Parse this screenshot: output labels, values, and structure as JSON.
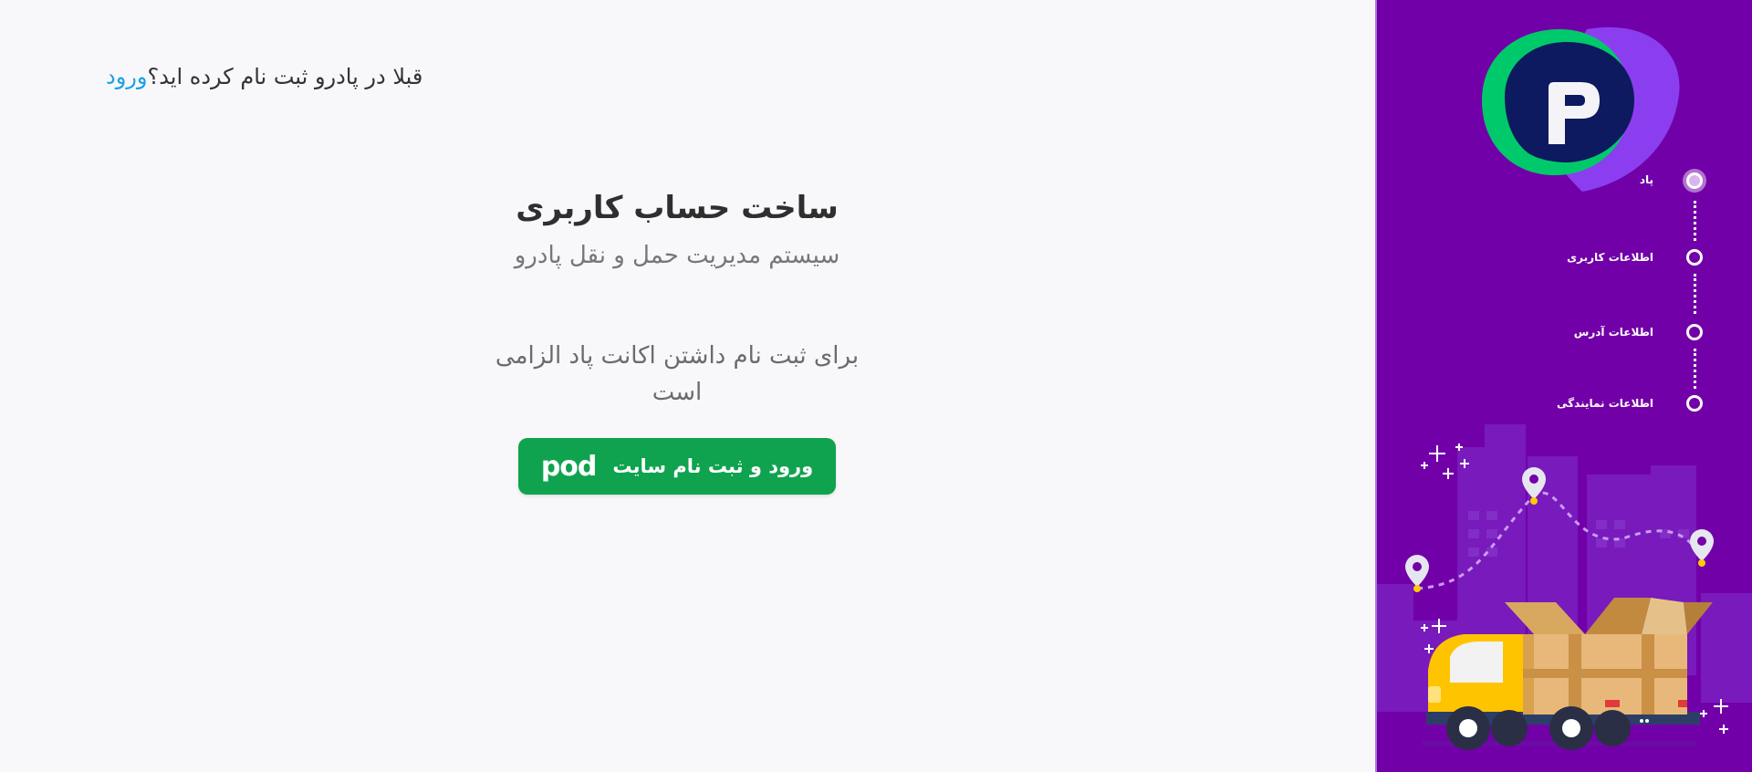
{
  "header": {
    "login_prompt": "قبلا در پادرو ثبت نام کرده اید؟",
    "login_link": "ورود"
  },
  "main": {
    "title": "ساخت حساب کاربری",
    "subtitle": "سیستم مدیریت حمل و نقل پادرو",
    "notice": "برای ثبت نام داشتن اکانت پاد الزامی است",
    "pod_button_label": "ورود و ثبت نام سایت",
    "pod_logo_text": "pod"
  },
  "sidebar": {
    "steps": [
      {
        "label": "پاد",
        "active": true
      },
      {
        "label": "اطلاعات کاربری",
        "active": false
      },
      {
        "label": "اطلاعات آدرس",
        "active": false
      },
      {
        "label": "اطلاعات نمایندگی",
        "active": false
      }
    ]
  },
  "colors": {
    "accent_link": "#1ba1e2",
    "button_green": "#0fa34f",
    "sidebar_purple": "#7200a8",
    "logo_green": "#00c96b",
    "logo_navy": "#0d1a5f",
    "logo_violet": "#8b3ef0"
  }
}
